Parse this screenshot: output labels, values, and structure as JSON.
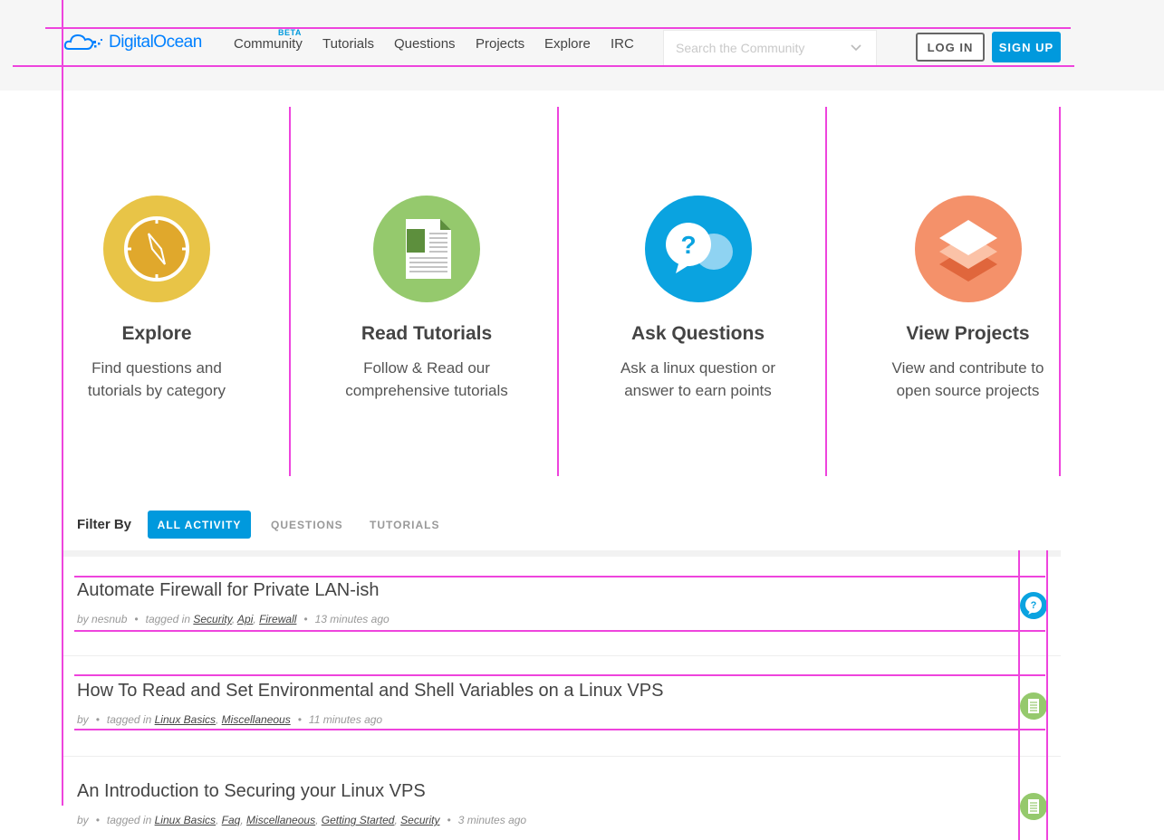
{
  "header": {
    "logo_text": "DigitalOcean",
    "nav": [
      {
        "label": "Community",
        "badge": "BETA"
      },
      {
        "label": "Tutorials"
      },
      {
        "label": "Questions"
      },
      {
        "label": "Projects"
      },
      {
        "label": "Explore"
      },
      {
        "label": "IRC"
      }
    ],
    "search_placeholder": "Search the Community",
    "login_label": "LOG IN",
    "signup_label": "SIGN UP"
  },
  "features": [
    {
      "title": "Explore",
      "desc1": "Find questions and",
      "desc2": "tutorials by category",
      "color": "#e8c447",
      "icon": "compass-icon"
    },
    {
      "title": "Read Tutorials",
      "desc1": "Follow & Read our",
      "desc2": "comprehensive tutorials",
      "color": "#95c96d",
      "icon": "document-icon"
    },
    {
      "title": "Ask Questions",
      "desc1": "Ask a linux question or",
      "desc2": "answer to earn points",
      "color": "#0aa3e0",
      "icon": "chat-bubble-icon"
    },
    {
      "title": "View Projects",
      "desc1": "View and contribute to",
      "desc2": "open source projects",
      "color": "#f4916a",
      "icon": "layers-icon"
    }
  ],
  "filter": {
    "label": "Filter By",
    "active": "ALL ACTIVITY",
    "options": [
      "QUESTIONS",
      "TUTORIALS"
    ]
  },
  "feed": [
    {
      "title": "Automate Firewall for Private LAN-ish",
      "by": "by",
      "author": "nesnub",
      "tagged": "tagged in",
      "tags": [
        "Security",
        "Api",
        "Firewall"
      ],
      "time": "13 minutes ago",
      "kind": "question"
    },
    {
      "title": "How To Read and Set Environmental and Shell Variables on a Linux VPS",
      "by": "by",
      "author": "",
      "tagged": "tagged in",
      "tags": [
        "Linux Basics",
        "Miscellaneous"
      ],
      "time": "11 minutes ago",
      "kind": "tutorial"
    },
    {
      "title": "An Introduction to Securing your Linux VPS",
      "by": "by",
      "author": "",
      "tagged": "tagged in",
      "tags": [
        "Linux Basics",
        "Faq",
        "Miscellaneous",
        "Getting Started",
        "Security"
      ],
      "time": "3 minutes ago",
      "kind": "tutorial"
    }
  ],
  "colors": {
    "brand": "#0080ff",
    "accent": "#0099dd",
    "question_icon": "#0aa3e0",
    "tutorial_icon": "#95c96d",
    "overlay": "#ee44dd"
  }
}
